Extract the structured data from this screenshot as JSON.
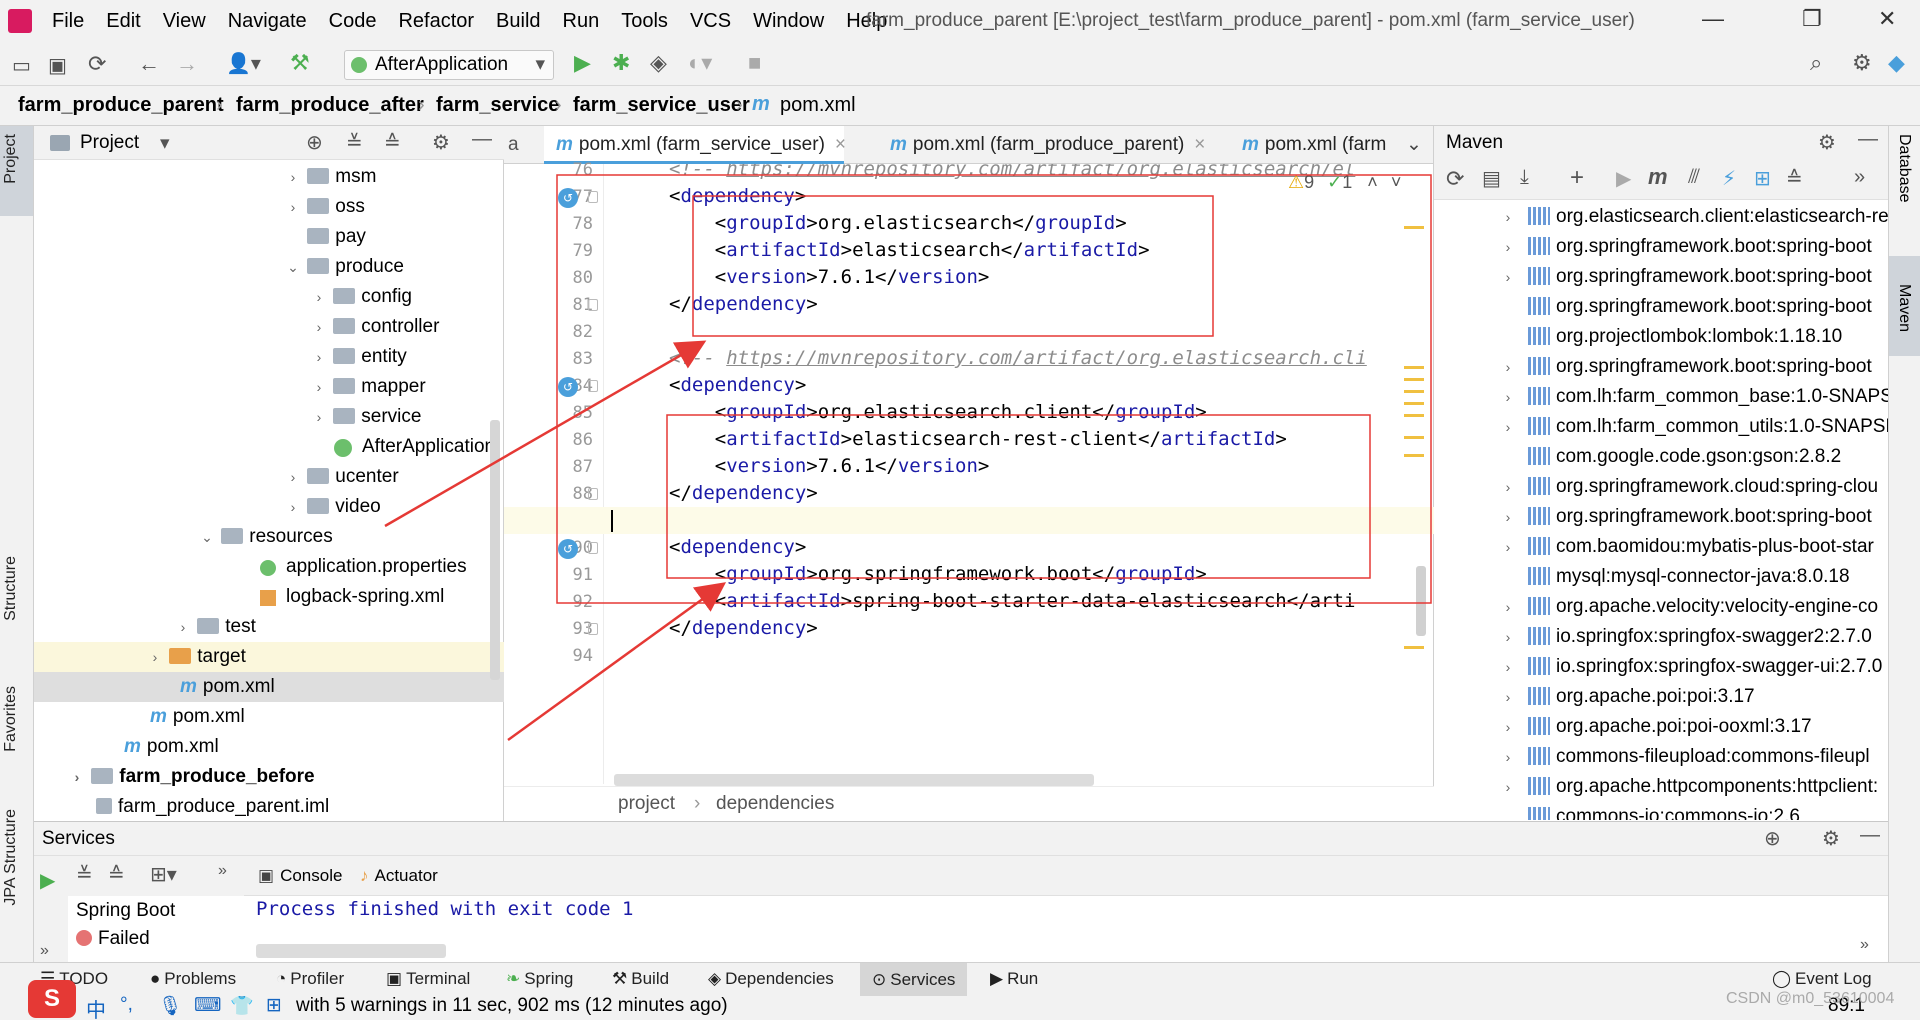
{
  "window": {
    "title": "farm_produce_parent [E:\\project_test\\farm_produce_parent] - pom.xml (farm_service_user)"
  },
  "menu": [
    "File",
    "Edit",
    "View",
    "Navigate",
    "Code",
    "Refactor",
    "Build",
    "Run",
    "Tools",
    "VCS",
    "Window",
    "Help"
  ],
  "toolbar": {
    "run_config": "AfterApplication"
  },
  "breadcrumbs": [
    "farm_produce_parent",
    "farm_produce_after",
    "farm_service",
    "farm_service_user",
    "pom.xml"
  ],
  "project_panel": {
    "title": "Project",
    "rows": [
      {
        "label": "msm",
        "indent": 0
      },
      {
        "label": "oss",
        "indent": 0
      },
      {
        "label": "pay",
        "indent": 0
      },
      {
        "label": "produce",
        "indent": 0
      },
      {
        "label": "config",
        "indent": 1
      },
      {
        "label": "controller",
        "indent": 1
      },
      {
        "label": "entity",
        "indent": 1
      },
      {
        "label": "mapper",
        "indent": 1
      },
      {
        "label": "service",
        "indent": 1
      },
      {
        "label": "AfterApplication",
        "indent": 1
      },
      {
        "label": "ucenter",
        "indent": 0
      },
      {
        "label": "video",
        "indent": 0
      },
      {
        "label": "resources",
        "indent": -1
      },
      {
        "label": "application.properties",
        "indent": 0
      },
      {
        "label": "logback-spring.xml",
        "indent": 0
      },
      {
        "label": "test",
        "indent": -2
      },
      {
        "label": "target",
        "indent": -3
      },
      {
        "label": "pom.xml",
        "indent": -3
      },
      {
        "label": "pom.xml",
        "indent": -4
      },
      {
        "label": "pom.xml",
        "indent": -5
      },
      {
        "label": "farm_produce_before",
        "indent": -6
      },
      {
        "label": "farm_produce_parent.iml",
        "indent": -5
      }
    ]
  },
  "editor": {
    "tabs": [
      "pom.xml (farm_service_user)",
      "pom.xml (farm_produce_parent)",
      "pom.xml (farm"
    ],
    "inspections": {
      "warnings": "9",
      "ok": "1"
    },
    "lines": [
      {
        "n": "76",
        "text": "<!-- https://mvnrepository.com/artifact/org.elasticsearch/el"
      },
      {
        "n": "77",
        "text": "<dependency>"
      },
      {
        "n": "78",
        "text": "    <groupId>org.elasticsearch</groupId>"
      },
      {
        "n": "79",
        "text": "    <artifactId>elasticsearch</artifactId>"
      },
      {
        "n": "80",
        "text": "    <version>7.6.1</version>"
      },
      {
        "n": "81",
        "text": "</dependency>"
      },
      {
        "n": "82",
        "text": ""
      },
      {
        "n": "83",
        "text": "<!-- https://mvnrepository.com/artifact/org.elasticsearch.cli"
      },
      {
        "n": "84",
        "text": "<dependency>"
      },
      {
        "n": "85",
        "text": "    <groupId>org.elasticsearch.client</groupId>"
      },
      {
        "n": "86",
        "text": "    <artifactId>elasticsearch-rest-client</artifactId>"
      },
      {
        "n": "87",
        "text": "    <version>7.6.1</version>"
      },
      {
        "n": "88",
        "text": "</dependency>"
      },
      {
        "n": "89",
        "text": ""
      },
      {
        "n": "90",
        "text": "<dependency>"
      },
      {
        "n": "91",
        "text": "    <groupId>org.springframework.boot</groupId>"
      },
      {
        "n": "92",
        "text": "    <artifactId>spring-boot-starter-data-elasticsearch</arti"
      },
      {
        "n": "93",
        "text": "</dependency>"
      },
      {
        "n": "94",
        "text": ""
      }
    ],
    "breadcrumb": [
      "project",
      "dependencies"
    ]
  },
  "maven": {
    "title": "Maven",
    "items": [
      "org.elasticsearch.client:elasticsearch-re",
      "org.springframework.boot:spring-boot",
      "org.springframework.boot:spring-boot",
      "org.springframework.boot:spring-boot",
      "org.projectlombok:lombok:1.18.10",
      "org.springframework.boot:spring-boot",
      "com.lh:farm_common_base:1.0-SNAPSH",
      "com.lh:farm_common_utils:1.0-SNAPSH",
      "com.google.code.gson:gson:2.8.2",
      "org.springframework.cloud:spring-clou",
      "org.springframework.boot:spring-boot",
      "com.baomidou:mybatis-plus-boot-star",
      "mysql:mysql-connector-java:8.0.18",
      "org.apache.velocity:velocity-engine-co",
      "io.springfox:springfox-swagger2:2.7.0",
      "io.springfox:springfox-swagger-ui:2.7.0",
      "org.apache.poi:poi:3.17",
      "org.apache.poi:poi-ooxml:3.17",
      "commons-fileupload:commons-fileupl",
      "org.apache.httpcomponents:httpclient:",
      "commons-io:commons-io:2.6"
    ]
  },
  "services": {
    "title": "Services",
    "tabs": [
      "Console",
      "Actuator"
    ],
    "tree": [
      "Spring Boot",
      "Failed"
    ],
    "console_text": "Process finished with exit code 1"
  },
  "side_labels": {
    "left": [
      "Project",
      "Structure",
      "Favorites",
      "JPA Structure"
    ],
    "right": [
      "Database",
      "Maven"
    ]
  },
  "bottom_tabs": [
    "TODO",
    "Problems",
    "Profiler",
    "Terminal",
    "Spring",
    "Build",
    "Dependencies",
    "Services",
    "Run",
    "Event Log"
  ],
  "status": {
    "message": "with 5 warnings in 11 sec, 902 ms (12 minutes ago)",
    "position": "89:1",
    "watermark": "CSDN @m0_53610004",
    "ime": "中"
  },
  "colors": {
    "accent": "#4a9fdb",
    "tag": "#1a1aa6",
    "annotation": "#e53935"
  }
}
